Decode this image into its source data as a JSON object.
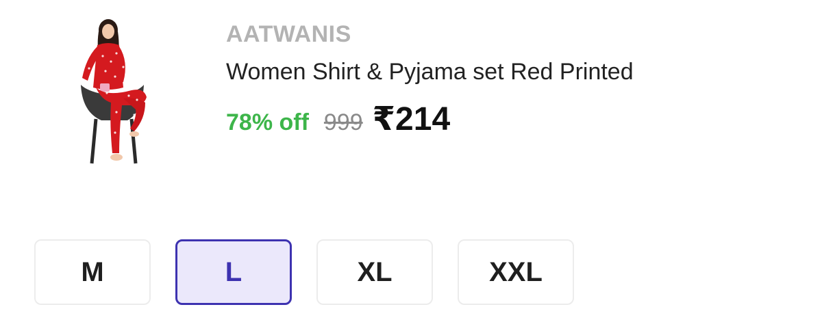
{
  "product": {
    "brand": "AATWANIS",
    "title": "Women Shirt & Pyjama set Red Printed",
    "discount": "78% off",
    "mrp": "999",
    "price": "₹214",
    "image_icon": "product-photo"
  },
  "sizes": {
    "options": [
      "M",
      "L",
      "XL",
      "XXL"
    ],
    "selected": "L"
  },
  "colors": {
    "brand_text": "#b3b3b3",
    "discount": "#3db54a",
    "mrp": "#8a8a8a",
    "selected_border": "#3d32b0",
    "selected_bg": "#ebe8fb"
  }
}
